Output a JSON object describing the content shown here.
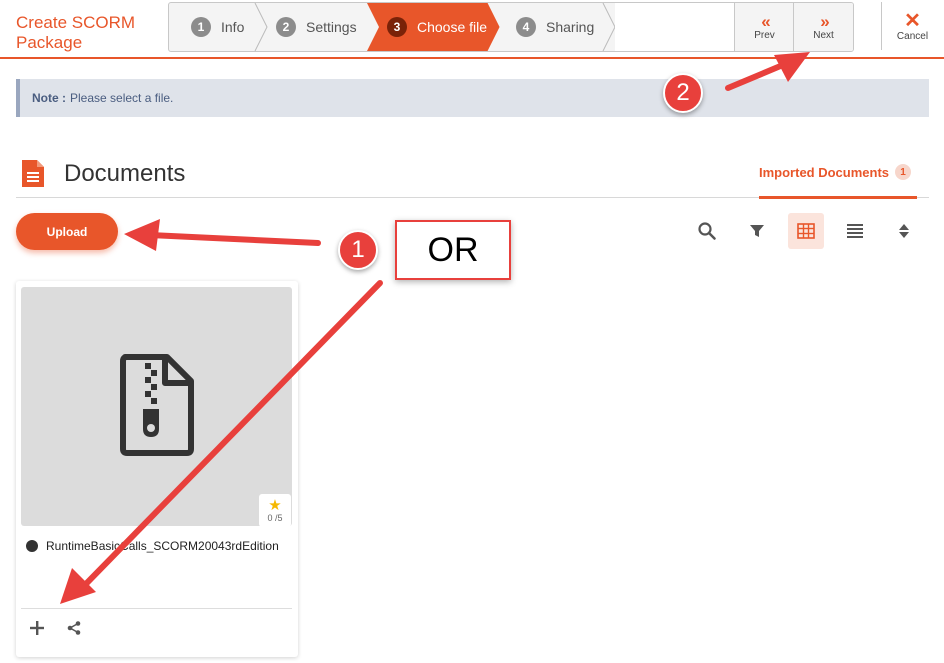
{
  "app": {
    "title": "Create SCORM Package"
  },
  "wizard": {
    "steps": [
      {
        "number": "1",
        "label": "Info"
      },
      {
        "number": "2",
        "label": "Settings"
      },
      {
        "number": "3",
        "label": "Choose file"
      },
      {
        "number": "4",
        "label": "Sharing"
      }
    ],
    "active_step": "3",
    "prev_label": "Prev",
    "next_label": "Next",
    "cancel_label": "Cancel"
  },
  "note": {
    "prefix": "Note :",
    "text": "Please select a file."
  },
  "documents": {
    "title": "Documents",
    "tab_label": "Imported Documents",
    "tab_count": "1",
    "upload_label": "Upload",
    "toolbar_icons": [
      "search-icon",
      "filter-icon",
      "grid-view-icon",
      "list-view-icon",
      "sort-icon"
    ]
  },
  "card": {
    "file_name": "RuntimeBasicCalls_SCORM20043rdEdition",
    "rating": "0 /5",
    "icon": "zip-file-icon"
  },
  "annotations": {
    "badge_1": "1",
    "badge_2": "2",
    "or_text": "OR"
  },
  "colors": {
    "accent": "#e8562a",
    "annotation": "#e8403c",
    "note_bg": "#dfe3ea"
  }
}
